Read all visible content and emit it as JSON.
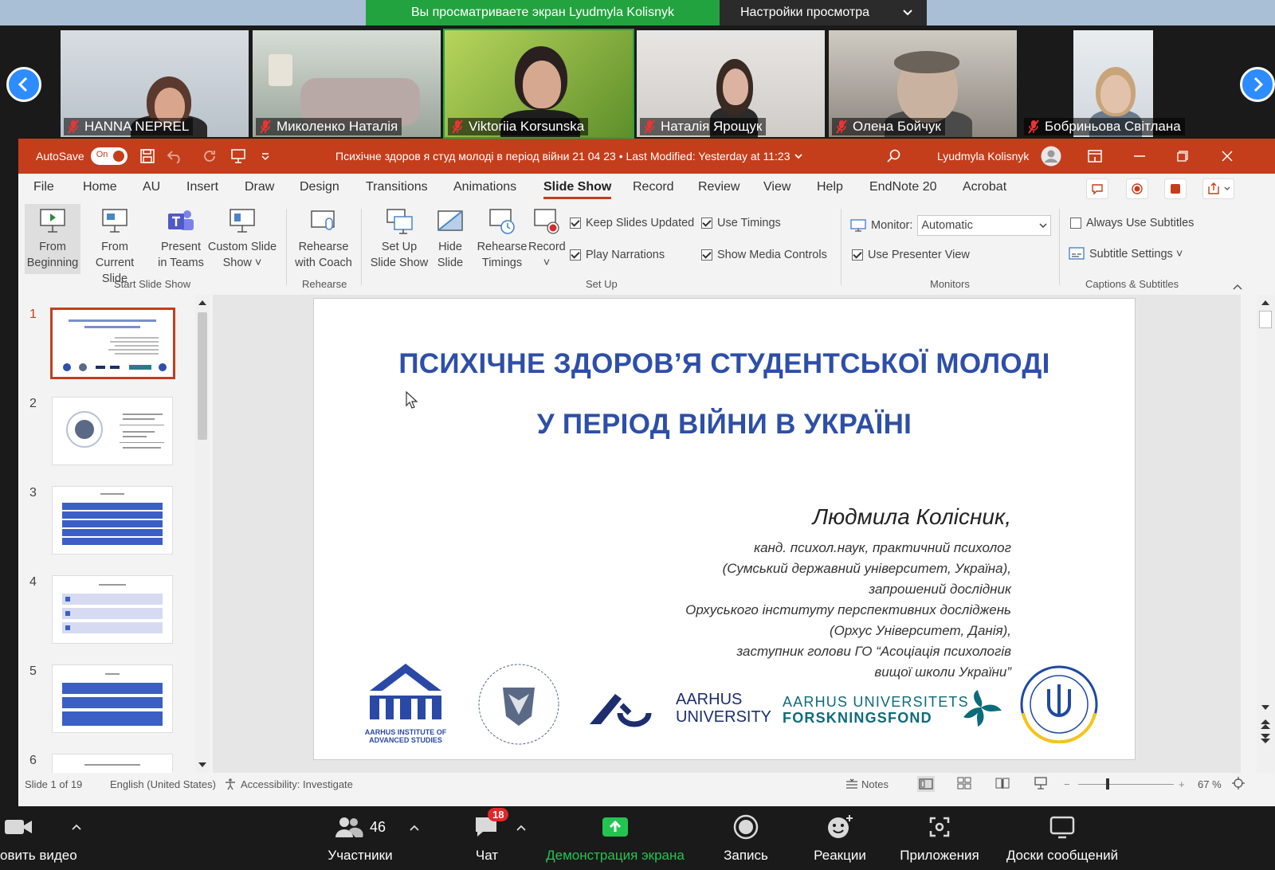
{
  "zoom_top": {
    "banner": "Вы просматриваете экран Lyudmyla Kolisnyk",
    "view_settings": "Настройки просмотра"
  },
  "participants": [
    {
      "name": "HANNA NEPREL"
    },
    {
      "name": "Миколенко Наталія"
    },
    {
      "name": "Viktoriia Korsunska"
    },
    {
      "name": "Наталія Ярощук"
    },
    {
      "name": "Олена Бойчук"
    },
    {
      "name": "Бобриньова Світлана"
    }
  ],
  "ppt": {
    "autosave_label": "AutoSave",
    "autosave_state": "On",
    "doc_title": "Психічне здоров я студ молоді в період війни 21 04 23 • Last Modified: Yesterday at 11:23",
    "user_name": "Lyudmyla Kolisnyk",
    "menu": [
      "File",
      "Home",
      "AU",
      "Insert",
      "Draw",
      "Design",
      "Transitions",
      "Animations",
      "Slide Show",
      "Record",
      "Review",
      "View",
      "Help",
      "EndNote 20",
      "Acrobat"
    ],
    "ribbon": {
      "from_beginning_1": "From",
      "from_beginning_2": "Beginning",
      "from_current_1": "From",
      "from_current_2": "Current Slide",
      "present_teams_1": "Present",
      "present_teams_2": "in Teams",
      "custom_show_1": "Custom Slide",
      "custom_show_2": "Show ˅",
      "group_start": "Start Slide Show",
      "rehearse_coach_1": "Rehearse",
      "rehearse_coach_2": "with Coach",
      "group_rehearse": "Rehearse",
      "setup_show_1": "Set Up",
      "setup_show_2": "Slide Show",
      "hide_slide_1": "Hide",
      "hide_slide_2": "Slide",
      "rehearse_timings_1": "Rehearse",
      "rehearse_timings_2": "Timings",
      "record_1": "Record",
      "record_2": "˅",
      "keep_updated": "Keep Slides Updated",
      "use_timings": "Use Timings",
      "play_narrations": "Play Narrations",
      "show_media": "Show Media Controls",
      "group_setup": "Set Up",
      "monitor_label": "Monitor:",
      "monitor_value": "Automatic",
      "presenter_view": "Use Presenter View",
      "group_monitors": "Monitors",
      "always_subtitles": "Always Use Subtitles",
      "subtitle_settings": "Subtitle Settings ˅",
      "group_captions": "Captions & Subtitles"
    },
    "slide_numbers": [
      "1",
      "2",
      "3",
      "4",
      "5",
      "6"
    ],
    "slide": {
      "title_1": "ПСИХІЧНЕ ЗДОРОВ’Я СТУДЕНТСЬКОЇ МОЛОДІ",
      "title_2": "У ПЕРІОД ВІЙНИ В УКРАЇНІ",
      "author": "Людмила Колісник,",
      "lines": [
        "канд. психол.наук, практичний психолог",
        "(Сумський державний університет, Україна),",
        "запрошений дослідник",
        "Орхуського інституту перспективних досліджень",
        "(Орхус Університет, Данія),",
        "заступник голови ГО “Асоціація психологів",
        "вищої школи України”"
      ],
      "logo_aias": "AARHUS INSTITUTE OF ADVANCED STUDIES",
      "logo_au_1": "AARHUS",
      "logo_au_2": "UNIVERSITY",
      "logo_auf_1": "AARHUS UNIVERSITETS",
      "logo_auf_2": "FORSKNINGSFOND"
    },
    "status": {
      "slide_of": "Slide 1 of 19",
      "language": "English (United States)",
      "accessibility": "Accessibility: Investigate",
      "notes": "Notes",
      "zoom": "67 %"
    }
  },
  "zoom_bar": {
    "video": "овить видео",
    "participants": "Участники",
    "participants_count": "46",
    "chat": "Чат",
    "chat_badge": "18",
    "share": "Демонстрация экрана",
    "record": "Запись",
    "reactions": "Реакции",
    "apps": "Приложения",
    "whiteboards": "Доски сообщений"
  }
}
